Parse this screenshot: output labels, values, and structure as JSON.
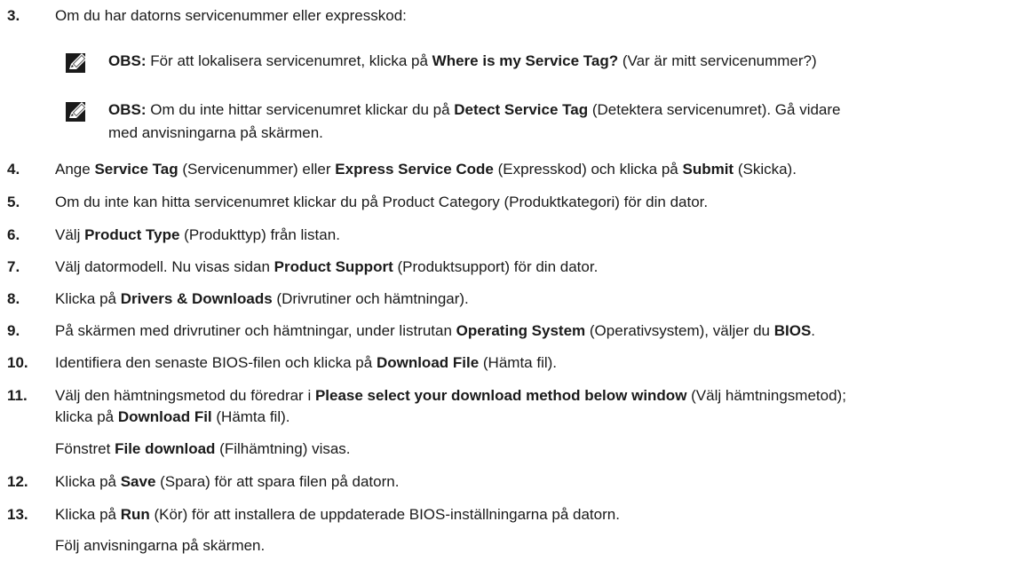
{
  "steps": {
    "s3": {
      "num": "3.",
      "text": "Om du har datorns servicenummer eller expresskod:"
    },
    "note1": {
      "label": "OBS:",
      "t1": " För att lokalisera servicenumret, klicka på ",
      "b1": "Where is my Service Tag?",
      "t2": " (Var är mitt servicenummer?)"
    },
    "note2": {
      "label": "OBS:",
      "t1": " Om du inte hittar servicenumret klickar du på ",
      "b1": "Detect Service Tag",
      "t2": " (Detektera servicenumret). Gå vidare",
      "line2": "med anvisningarna på skärmen."
    },
    "s4": {
      "num": "4.",
      "t1": "Ange ",
      "b1": "Service Tag",
      "t2": " (Servicenummer) eller ",
      "b2": "Express Service Code",
      "t3": " (Expresskod) och klicka på ",
      "b3": "Submit",
      "t4": " (Skicka)."
    },
    "s5": {
      "num": "5.",
      "text": "Om du inte kan hitta servicenumret klickar du på Product Category (Produktkategori) för din dator."
    },
    "s6": {
      "num": "6.",
      "t1": "Välj ",
      "b1": "Product Type",
      "t2": " (Produkttyp) från listan."
    },
    "s7": {
      "num": "7.",
      "t1": "Välj datormodell. Nu visas sidan ",
      "b1": "Product Support",
      "t2": " (Produktsupport) för din dator."
    },
    "s8": {
      "num": "8.",
      "t1": "Klicka på ",
      "b1": "Drivers & Downloads",
      "t2": " (Drivrutiner och hämtningar)."
    },
    "s9": {
      "num": "9.",
      "t1": "På skärmen med drivrutiner och hämtningar, under listrutan ",
      "b1": "Operating System",
      "t2": " (Operativsystem), väljer du ",
      "b2": "BIOS",
      "t3": "."
    },
    "s10": {
      "num": "10.",
      "t1": "Identifiera den senaste BIOS-filen och klicka på ",
      "b1": "Download File",
      "t2": " (Hämta fil)."
    },
    "s11": {
      "num": "11.",
      "t1": "Välj den hämtningsmetod du föredrar i ",
      "b1": "Please select your download method below window",
      "t2": " (Välj hämtningsmetod);",
      "line2a": "klicka på ",
      "line2b": "Download Fil",
      "line2c": " (Hämta fil)."
    },
    "s11sub": {
      "t1": "Fönstret ",
      "b1": "File download",
      "t2": " (Filhämtning) visas."
    },
    "s12": {
      "num": "12.",
      "t1": "Klicka på ",
      "b1": "Save",
      "t2": " (Spara) för att spara filen på datorn."
    },
    "s13": {
      "num": "13.",
      "t1": "Klicka på ",
      "b1": "Run",
      "t2": " (Kör) för att installera de uppdaterade BIOS-inställningarna på datorn."
    },
    "s13sub": {
      "text": "Följ anvisningarna på skärmen."
    }
  },
  "icons": {
    "note": "pencil-note-icon"
  }
}
